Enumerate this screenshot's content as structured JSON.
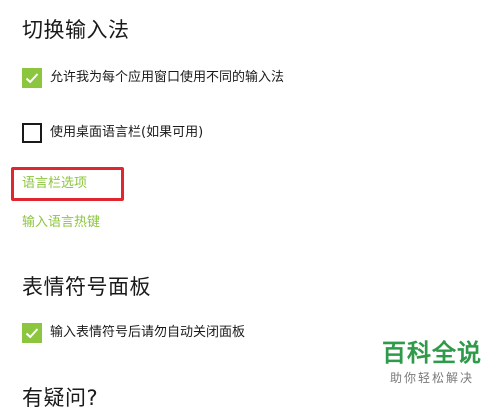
{
  "section_ime": {
    "title": "切换输入法",
    "option_per_app": {
      "label": "允许我为每个应用窗口使用不同的输入法",
      "checked": true
    },
    "option_langbar": {
      "label": "使用桌面语言栏(如果可用)",
      "checked": false
    },
    "link_langbar_options": "语言栏选项",
    "link_hotkeys": "输入语言热键"
  },
  "section_emoji": {
    "title": "表情符号面板",
    "option_autoclose": {
      "label": "输入表情符号后请勿自动关闭面板",
      "checked": true
    }
  },
  "section_faq": {
    "title": "有疑问?"
  },
  "watermark": {
    "main": "百科全说",
    "sub": "助你轻松解决"
  },
  "colors": {
    "accent": "#8cc63f",
    "highlight": "#e0262e",
    "watermark_green": "#2e9a4a",
    "text": "#1a1a1a"
  }
}
